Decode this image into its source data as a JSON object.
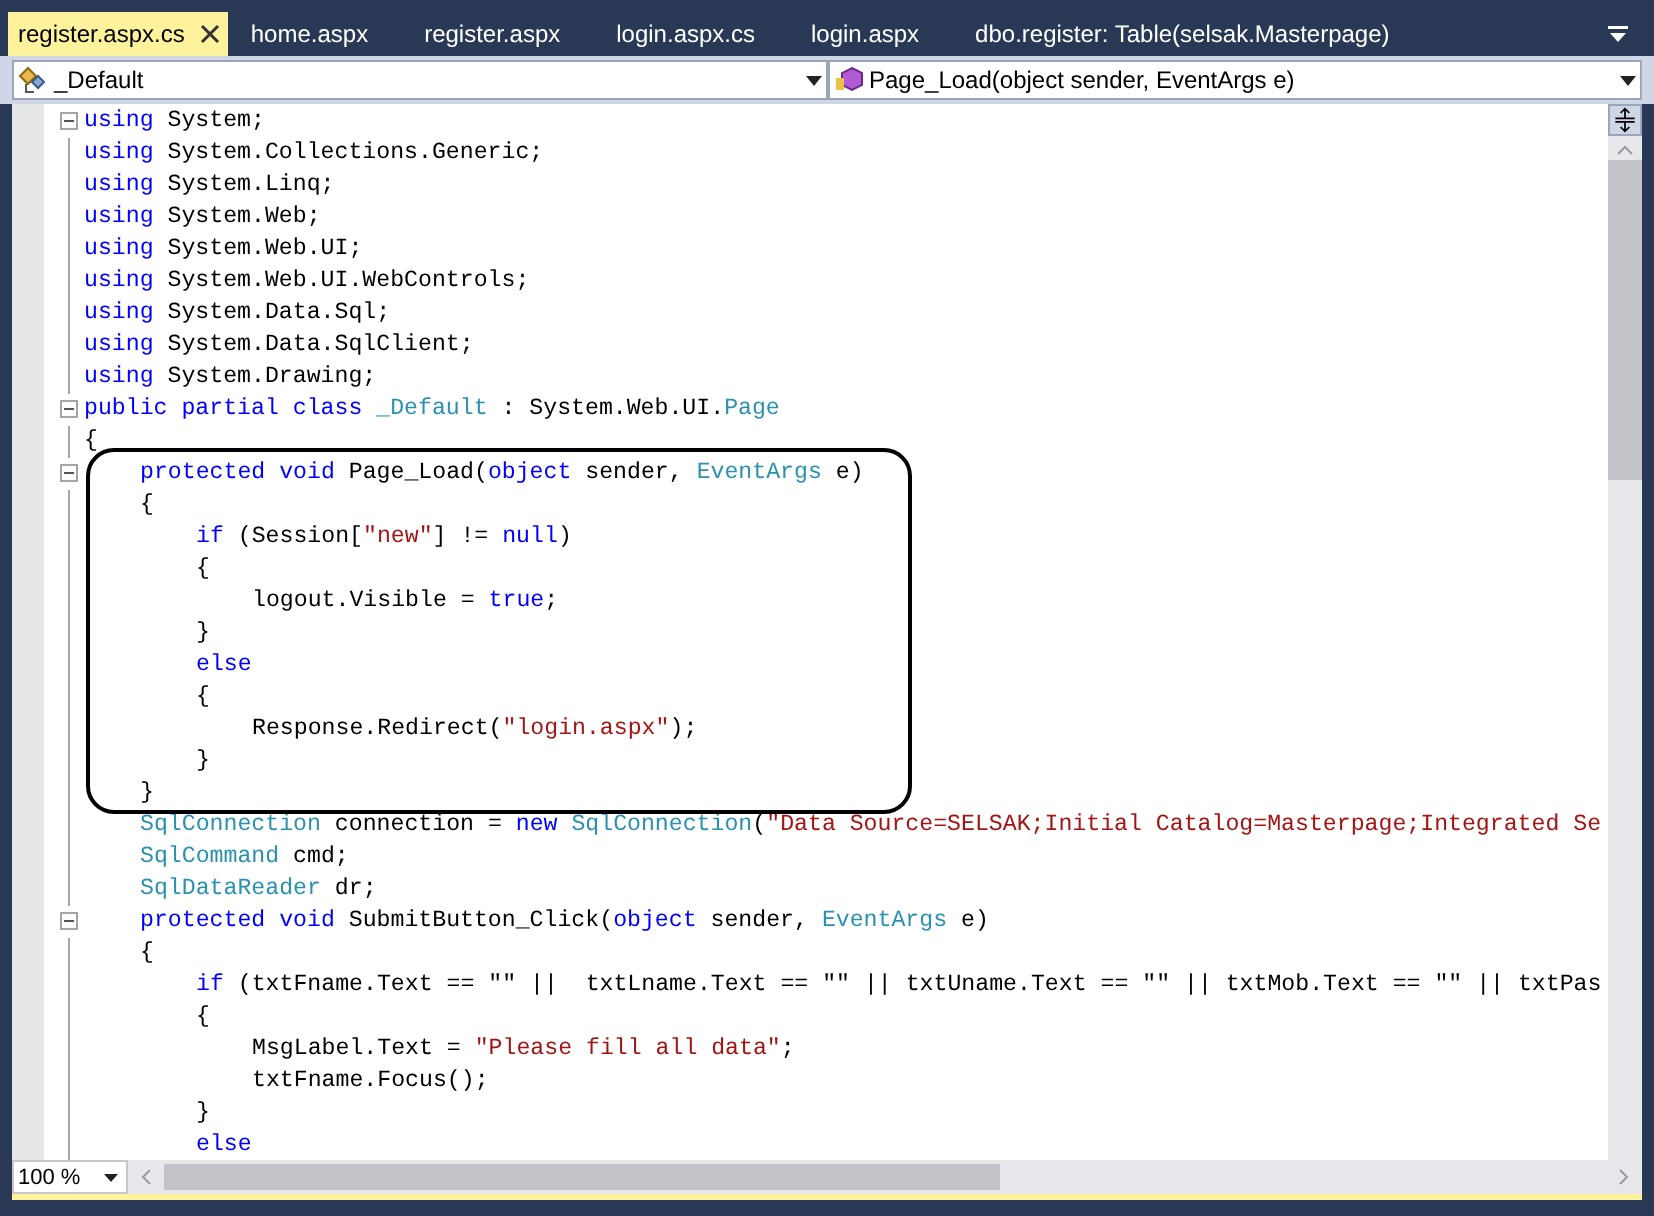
{
  "tabs": [
    {
      "label": "register.aspx.cs",
      "selected": true,
      "closable": true
    },
    {
      "label": "home.aspx",
      "selected": false,
      "closable": false
    },
    {
      "label": "register.aspx",
      "selected": false,
      "closable": false
    },
    {
      "label": "login.aspx.cs",
      "selected": false,
      "closable": false
    },
    {
      "label": "login.aspx",
      "selected": false,
      "closable": false
    },
    {
      "label": "dbo.register: Table(selsak.Masterpage)",
      "selected": false,
      "closable": false
    }
  ],
  "navigation": {
    "type_dropdown": "_Default",
    "member_dropdown": "Page_Load(object sender, EventArgs e)"
  },
  "code_lines": [
    {
      "fold": true,
      "tokens": [
        {
          "kind": "keyword",
          "text": "using"
        },
        {
          "kind": "plain",
          "text": " System;"
        }
      ]
    },
    {
      "fold": false,
      "tokens": [
        {
          "kind": "keyword",
          "text": "using"
        },
        {
          "kind": "plain",
          "text": " System.Collections.Generic;"
        }
      ]
    },
    {
      "fold": false,
      "tokens": [
        {
          "kind": "keyword",
          "text": "using"
        },
        {
          "kind": "plain",
          "text": " System.Linq;"
        }
      ]
    },
    {
      "fold": false,
      "tokens": [
        {
          "kind": "keyword",
          "text": "using"
        },
        {
          "kind": "plain",
          "text": " System.Web;"
        }
      ]
    },
    {
      "fold": false,
      "tokens": [
        {
          "kind": "keyword",
          "text": "using"
        },
        {
          "kind": "plain",
          "text": " System.Web.UI;"
        }
      ]
    },
    {
      "fold": false,
      "tokens": [
        {
          "kind": "keyword",
          "text": "using"
        },
        {
          "kind": "plain",
          "text": " System.Web.UI.WebControls;"
        }
      ]
    },
    {
      "fold": false,
      "tokens": [
        {
          "kind": "keyword",
          "text": "using"
        },
        {
          "kind": "plain",
          "text": " System.Data.Sql;"
        }
      ]
    },
    {
      "fold": false,
      "tokens": [
        {
          "kind": "keyword",
          "text": "using"
        },
        {
          "kind": "plain",
          "text": " System.Data.SqlClient;"
        }
      ]
    },
    {
      "fold": false,
      "tokens": [
        {
          "kind": "keyword",
          "text": "using"
        },
        {
          "kind": "plain",
          "text": " System.Drawing;"
        }
      ]
    },
    {
      "fold": true,
      "tokens": [
        {
          "kind": "keyword",
          "text": "public partial class"
        },
        {
          "kind": "type",
          "text": " _Default"
        },
        {
          "kind": "plain",
          "text": " : System.Web.UI."
        },
        {
          "kind": "type",
          "text": "Page"
        }
      ]
    },
    {
      "fold": false,
      "tokens": [
        {
          "kind": "plain",
          "text": "{"
        }
      ],
      "children": [
        {
          "fold": true,
          "highlighted": true,
          "tokens": [
            {
              "kind": "keyword",
              "text": "protected void"
            },
            {
              "kind": "plain",
              "text": " Page_Load("
            },
            {
              "kind": "keyword",
              "text": "object"
            },
            {
              "kind": "plain",
              "text": " sender, "
            },
            {
              "kind": "type",
              "text": "EventArgs"
            },
            {
              "kind": "plain",
              "text": " e)"
            }
          ]
        },
        {
          "fold": false,
          "highlighted": true,
          "tokens": [
            {
              "kind": "plain",
              "text": "{"
            }
          ],
          "children": [
            {
              "fold": false,
              "tokens": [
                {
                  "kind": "keyword",
                  "text": "if"
                },
                {
                  "kind": "plain",
                  "text": " (Session["
                },
                {
                  "kind": "string",
                  "text": "\"new\""
                },
                {
                  "kind": "plain",
                  "text": "] != "
                },
                {
                  "kind": "keyword",
                  "text": "null"
                },
                {
                  "kind": "plain",
                  "text": ")"
                }
              ]
            },
            {
              "fold": false,
              "tokens": [
                {
                  "kind": "plain",
                  "text": "{"
                }
              ],
              "children": [
                {
                  "fold": false,
                  "tokens": [
                    {
                      "kind": "plain",
                      "text": "logout.Visible = "
                    },
                    {
                      "kind": "keyword",
                      "text": "true"
                    },
                    {
                      "kind": "plain",
                      "text": ";"
                    }
                  ]
                }
              ]
            },
            {
              "fold": false,
              "tokens": [
                {
                  "kind": "plain",
                  "text": "}"
                }
              ]
            },
            {
              "fold": false,
              "tokens": [
                {
                  "kind": "keyword",
                  "text": "else"
                }
              ]
            },
            {
              "fold": false,
              "tokens": [
                {
                  "kind": "plain",
                  "text": "{"
                }
              ],
              "children": [
                {
                  "fold": false,
                  "tokens": [
                    {
                      "kind": "plain",
                      "text": "Response.Redirect("
                    },
                    {
                      "kind": "string",
                      "text": "\"login.aspx\""
                    },
                    {
                      "kind": "plain",
                      "text": ");"
                    }
                  ]
                }
              ]
            },
            {
              "fold": false,
              "tokens": [
                {
                  "kind": "plain",
                  "text": "}"
                }
              ]
            }
          ]
        },
        {
          "fold": false,
          "highlighted": true,
          "tokens": [
            {
              "kind": "plain",
              "text": "}"
            }
          ]
        },
        {
          "fold": false,
          "highlighted": false,
          "tokens": [
            {
              "kind": "type",
              "text": "SqlConnection"
            },
            {
              "kind": "plain",
              "text": " connection = "
            },
            {
              "kind": "keyword",
              "text": "new"
            },
            {
              "kind": "type",
              "text": " SqlConnection"
            },
            {
              "kind": "plain",
              "text": "("
            },
            {
              "kind": "string",
              "text": "\"Data Source=SELSAK;Initial Catalog=Masterpage;Integrated Se"
            }
          ]
        },
        {
          "fold": false,
          "highlighted": false,
          "tokens": [
            {
              "kind": "type",
              "text": "SqlCommand"
            },
            {
              "kind": "plain",
              "text": " cmd;"
            }
          ]
        },
        {
          "fold": false,
          "highlighted": false,
          "tokens": [
            {
              "kind": "type",
              "text": "SqlDataReader"
            },
            {
              "kind": "plain",
              "text": " dr;"
            }
          ]
        },
        {
          "fold": true,
          "highlighted": false,
          "tokens": [
            {
              "kind": "keyword",
              "text": "protected void"
            },
            {
              "kind": "plain",
              "text": " SubmitButton_Click("
            },
            {
              "kind": "keyword",
              "text": "object"
            },
            {
              "kind": "plain",
              "text": " sender, "
            },
            {
              "kind": "type",
              "text": "EventArgs"
            },
            {
              "kind": "plain",
              "text": " e)"
            }
          ]
        },
        {
          "fold": false,
          "highlighted": false,
          "tokens": [
            {
              "kind": "plain",
              "text": "{"
            }
          ],
          "children": [
            {
              "fold": false,
              "tokens": [
                {
                  "kind": "keyword",
                  "text": "if"
                },
                {
                  "kind": "plain",
                  "text": " (txtFname.Text == \"\" ||  txtLname.Text == \"\" || txtUname.Text == \"\" || txtMob.Text == \"\" || txtPas"
                }
              ]
            },
            {
              "fold": false,
              "tokens": [
                {
                  "kind": "plain",
                  "text": "{"
                }
              ],
              "children": [
                {
                  "fold": false,
                  "tokens": [
                    {
                      "kind": "plain",
                      "text": "MsgLabel.Text = "
                    },
                    {
                      "kind": "string",
                      "text": "\"Please fill all data\""
                    },
                    {
                      "kind": "plain",
                      "text": ";"
                    }
                  ]
                },
                {
                  "fold": false,
                  "tokens": [
                    {
                      "kind": "plain",
                      "text": "txtFname.Focus();"
                    }
                  ]
                }
              ]
            },
            {
              "fold": false,
              "tokens": [
                {
                  "kind": "plain",
                  "text": "}"
                }
              ]
            },
            {
              "fold": false,
              "tokens": [
                {
                  "kind": "keyword",
                  "text": "else"
                }
              ]
            }
          ]
        }
      ]
    }
  ],
  "zoom": "100 %"
}
